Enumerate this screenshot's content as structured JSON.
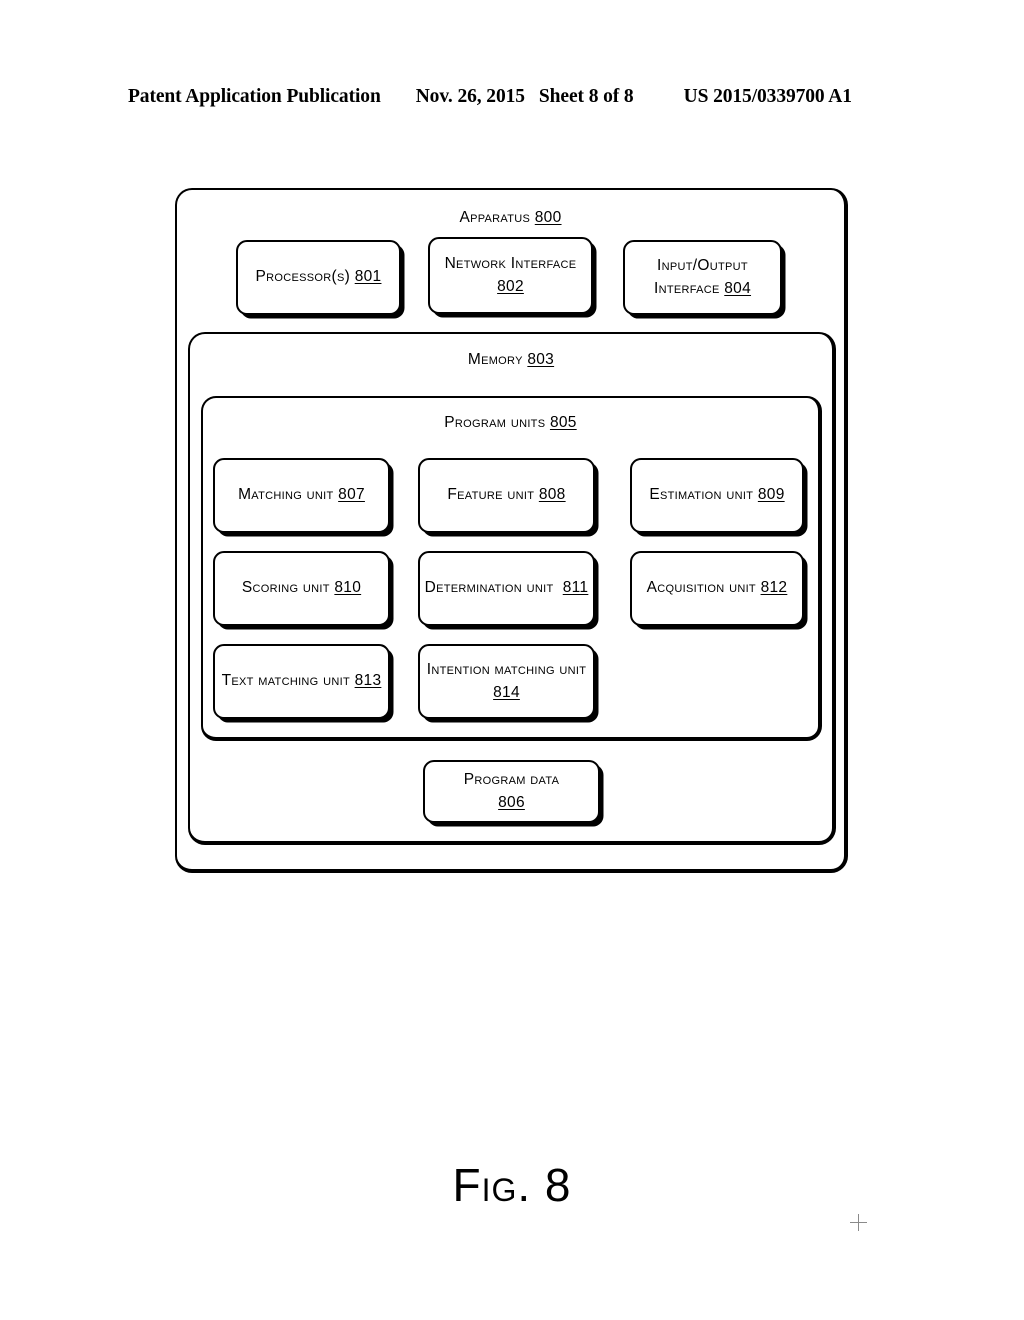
{
  "header": {
    "publication": "Patent Application Publication",
    "date": "Nov. 26, 2015",
    "sheet": "Sheet 8 of 8",
    "patent_number": "US 2015/0339700 A1"
  },
  "figure": {
    "caption": "Fig. 8"
  },
  "apparatus": {
    "title_label": "Apparatus ",
    "title_ref": "800",
    "top_boxes": [
      {
        "label": "Processor(s) ",
        "ref": "801"
      },
      {
        "label": "Network Interface ",
        "ref": "802"
      },
      {
        "label": "Input/Output\nInterface ",
        "ref": "804"
      }
    ],
    "memory": {
      "title_label": "Memory ",
      "title_ref": "803",
      "program_units": {
        "title_label": "Program units ",
        "title_ref": "805",
        "units": [
          {
            "label": "Matching unit ",
            "ref": "807"
          },
          {
            "label": "Feature unit ",
            "ref": "808"
          },
          {
            "label": "Estimation unit ",
            "ref": "809"
          },
          {
            "label": "Scoring unit ",
            "ref": "810"
          },
          {
            "label": "Determination unit  ",
            "ref": "811"
          },
          {
            "label": "Acquisition unit ",
            "ref": "812"
          },
          {
            "label": "Text matching unit ",
            "ref": "813"
          },
          {
            "label": "Intention matching unit\n",
            "ref": "814"
          }
        ]
      },
      "program_data": {
        "label": "Program data\n",
        "ref": "806"
      }
    }
  }
}
